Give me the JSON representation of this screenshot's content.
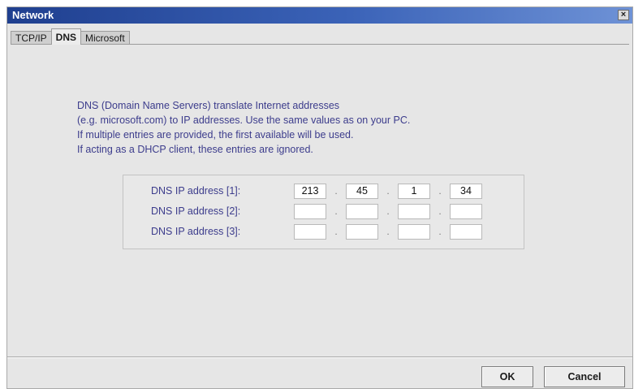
{
  "window": {
    "title": "Network",
    "close_label": "×"
  },
  "tabs": [
    {
      "label": "TCP/IP",
      "active": false
    },
    {
      "label": "DNS",
      "active": true
    },
    {
      "label": "Microsoft",
      "active": false
    }
  ],
  "description": [
    "DNS (Domain Name Servers) translate Internet addresses",
    "(e.g. microsoft.com) to IP addresses. Use the same values as on your PC.",
    "If multiple entries are provided, the first available will be used.",
    "If acting as a DHCP client, these entries are ignored."
  ],
  "dns_entries": [
    {
      "label": "DNS IP address [1]:",
      "octets": [
        "213",
        "45",
        "1",
        "34"
      ]
    },
    {
      "label": "DNS IP address [2]:",
      "octets": [
        "",
        "",
        "",
        ""
      ]
    },
    {
      "label": "DNS IP address [3]:",
      "octets": [
        "",
        "",
        "",
        ""
      ]
    }
  ],
  "octet_separator": ".",
  "buttons": {
    "ok_label": "OK",
    "cancel_label": "Cancel"
  }
}
